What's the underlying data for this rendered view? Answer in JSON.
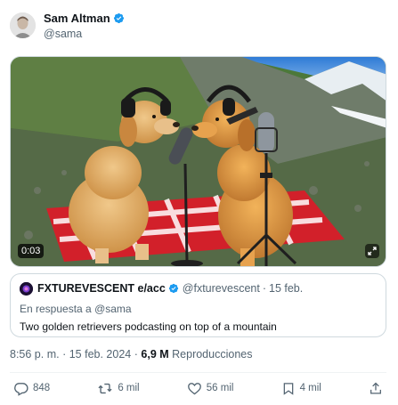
{
  "author": {
    "name": "Sam Altman",
    "handle": "@sama",
    "verified": true
  },
  "media": {
    "type": "video",
    "duration": "0:03",
    "expand_icon": "expand-icon"
  },
  "quote": {
    "name": "FXTUREVESCENT e/acc",
    "handle": "@fxturevescent",
    "separator": "·",
    "date": "15 feb.",
    "reply_prefix": "En respuesta a",
    "reply_mention": "@sama",
    "text": "Two golden retrievers podcasting on top of a mountain"
  },
  "meta": {
    "time": "8:56 p. m.",
    "separator": "·",
    "date": "15 feb. 2024",
    "separator2": "·",
    "views": "6,9 M",
    "views_label": "Reproducciones"
  },
  "actions": {
    "replies": "848",
    "reposts": "6 mil",
    "likes": "56 mil",
    "bookmarks": "4 mil"
  },
  "colors": {
    "verified": "#1d9bf0",
    "text_primary": "#0f1419",
    "text_secondary": "#536471",
    "border": "#cfd9de"
  }
}
